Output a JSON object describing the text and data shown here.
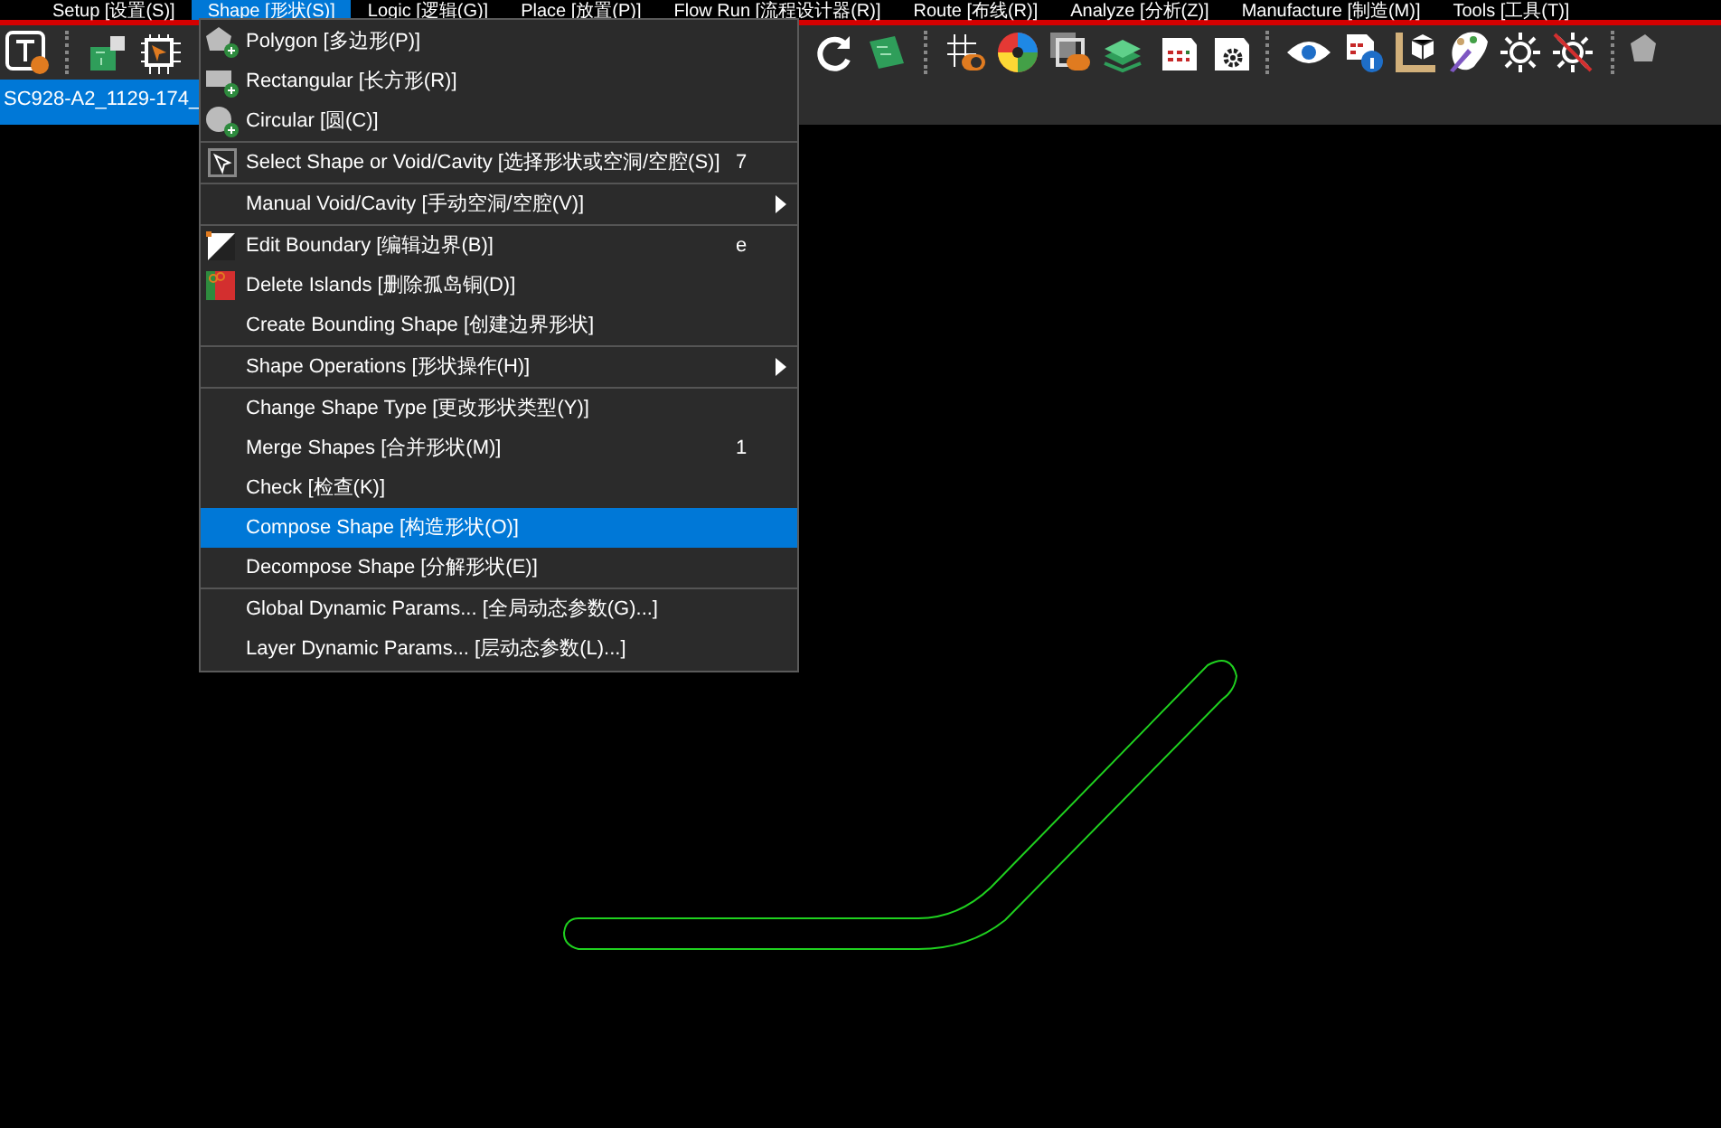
{
  "menu_bar": [
    {
      "label": "Setup [设置(S)]",
      "selected": false
    },
    {
      "label": "Shape [形状(S)]",
      "selected": true
    },
    {
      "label": "Logic [逻辑(G)]",
      "selected": false
    },
    {
      "label": "Place [放置(P)]",
      "selected": false
    },
    {
      "label": "Flow Run [流程设计器(R)]",
      "selected": false
    },
    {
      "label": "Route [布线(R)]",
      "selected": false
    },
    {
      "label": "Analyze [分析(Z)]",
      "selected": false
    },
    {
      "label": "Manufacture [制造(M)]",
      "selected": false
    },
    {
      "label": "Tools [工具(T)]",
      "selected": false
    }
  ],
  "document_tab": {
    "label": "SC928-A2_1129-174_",
    "selected": true
  },
  "shape_menu": [
    {
      "kind": "item",
      "label": "Polygon [多边形(P)]",
      "selected": false,
      "submenu": false
    },
    {
      "kind": "item",
      "label": "Rectangular [长方形(R)]",
      "selected": false,
      "submenu": false
    },
    {
      "kind": "item",
      "label": "Circular [圆(C)]",
      "selected": false,
      "submenu": false
    },
    {
      "kind": "separator"
    },
    {
      "kind": "item",
      "label": "Select Shape or Void/Cavity [选择形状或空洞/空腔(S)]",
      "shortcut": "7",
      "selected": false,
      "submenu": false
    },
    {
      "kind": "separator"
    },
    {
      "kind": "item",
      "label": "Manual Void/Cavity [手动空洞/空腔(V)]",
      "selected": false,
      "submenu": true
    },
    {
      "kind": "separator"
    },
    {
      "kind": "item",
      "label": "Edit Boundary [编辑边界(B)]",
      "shortcut": "e",
      "selected": false,
      "submenu": false
    },
    {
      "kind": "item",
      "label": "Delete Islands [删除孤岛铜(D)]",
      "selected": false,
      "submenu": false
    },
    {
      "kind": "item",
      "label": "Create Bounding Shape [创建边界形状]",
      "selected": false,
      "submenu": false
    },
    {
      "kind": "separator"
    },
    {
      "kind": "item",
      "label": "Shape Operations [形状操作(H)]",
      "selected": false,
      "submenu": true
    },
    {
      "kind": "separator"
    },
    {
      "kind": "item",
      "label": "Change Shape Type [更改形状类型(Y)]",
      "selected": false,
      "submenu": false
    },
    {
      "kind": "item",
      "label": "Merge Shapes [合并形状(M)]",
      "shortcut": "1",
      "selected": false,
      "submenu": false
    },
    {
      "kind": "item",
      "label": "Check [检查(K)]",
      "selected": false,
      "submenu": false
    },
    {
      "kind": "item",
      "label": "Compose Shape [构造形状(O)]",
      "selected": true,
      "submenu": false
    },
    {
      "kind": "item",
      "label": "Decompose Shape [分解形状(E)]",
      "selected": false,
      "submenu": false
    },
    {
      "kind": "separator"
    },
    {
      "kind": "item",
      "label": "Global Dynamic Params... [全局动态参数(G)...]",
      "selected": false,
      "submenu": false
    },
    {
      "kind": "item",
      "label": "Layer Dynamic Params... [层动态参数(L)...]",
      "selected": false,
      "submenu": false
    }
  ]
}
